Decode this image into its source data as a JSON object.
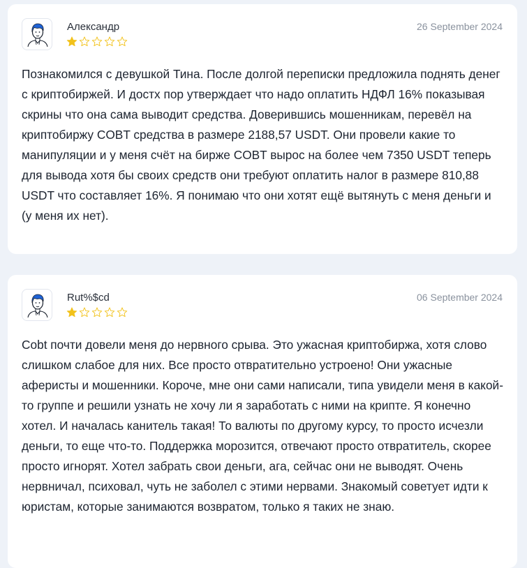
{
  "reviews": [
    {
      "author": "Александр",
      "date": "26 September 2024",
      "rating": 1,
      "rating_max": 5,
      "text": "Познакомился с девушкой Тина. После долгой переписки предложила поднять денег с криптобиржей. И достх пор утверждает что надо оплатить НДФЛ 16% показывая скрины что она сама выводит средства. Доверившись мошенникам, перевёл на криптобиржу COBT средства в размере 2188,57 USDT. Они провели какие то манипуляции и у меня счёт на бирже COBT вырос на более чем 7350 USDT теперь для вывода хотя бы своих средств они требуют оплатить налог в размере 810,88 USDT что составляет 16%. Я понимаю что они хотят ещё вытянуть с меня деньги и (у меня их нет)."
    },
    {
      "author": "Rut%$cd",
      "date": "06 September 2024",
      "rating": 1,
      "rating_max": 5,
      "text": "Cobt почти довели меня до нервного срыва. Это ужасная криптобиржа, хотя слово слишком слабое для них. Все просто отвратительно устроено! Они ужасные аферисты и мошенники. Короче, мне они сами написали, типа увидели меня в какой-то группе и решили узнать не хочу ли я заработать с ними на крипте. Я конечно хотел. И началась канитель такая! То валюты по другому курсу, то просто исчезли деньги, то еще что-то. Поддержка морозится, отвечают просто отвратитель, скорее просто игнорят. Хотел забрать свои деньги, ага, сейчас они не выводят. Очень нервничал, психовал, чуть не заболел с этими нервами. Знакомый советует идти к юристам, которые занимаются возвратом, только я таких не знаю."
    }
  ],
  "colors": {
    "star_filled": "#f2c21b",
    "star_empty_stroke": "#f2c21b",
    "card_bg": "#ffffff",
    "page_bg": "#eef2f8",
    "date_text": "#8a929e",
    "avatar_hair": "#1f63d6"
  },
  "icons": {
    "avatar": "user-avatar-icon",
    "star": "star-icon"
  }
}
